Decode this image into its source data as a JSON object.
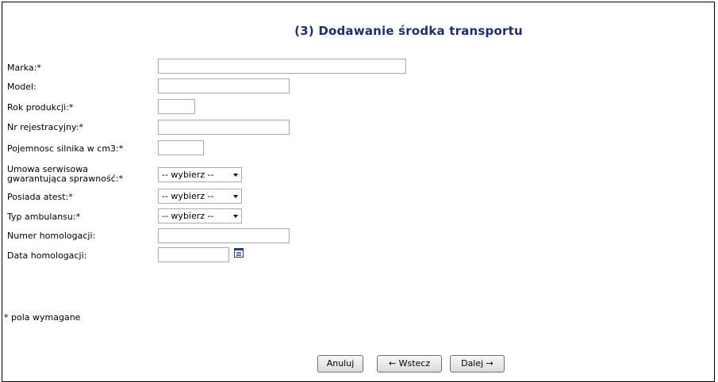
{
  "form": {
    "title": "(3) Dodawanie środka transportu",
    "fields": {
      "marka": {
        "label": "Marka:*",
        "value": ""
      },
      "model": {
        "label": "Model:",
        "value": ""
      },
      "rok_produkcji": {
        "label": "Rok produkcji:*",
        "value": ""
      },
      "nr_rejestracyjny": {
        "label": "Nr rejestracyjny:*",
        "value": ""
      },
      "pojemnosc": {
        "label": "Pojemnosc silnika w cm3:*",
        "value": ""
      },
      "umowa": {
        "label_line1": "Umowa serwisowa",
        "label_line2": "gwarantująca sprawność:*",
        "selected": "-- wybierz --"
      },
      "atest": {
        "label": "Posiada atest:*",
        "selected": "-- wybierz --"
      },
      "typ_ambulansu": {
        "label": "Typ ambulansu:*",
        "selected": "-- wybierz --"
      },
      "numer_homologacji": {
        "label": "Numer homologacji:",
        "value": ""
      },
      "data_homologacji": {
        "label": "Data homologacji:",
        "value": ""
      }
    },
    "icons": {
      "calendar": "calendar-icon",
      "select_arrow": "chevron-down-icon"
    },
    "colors": {
      "title": "#1f2d78",
      "calendar_icon": "#1f3c88"
    },
    "footnote": "* pola wymagane"
  },
  "buttons": {
    "cancel": "Anuluj",
    "back": "← Wstecz",
    "next": "Dalej →"
  }
}
